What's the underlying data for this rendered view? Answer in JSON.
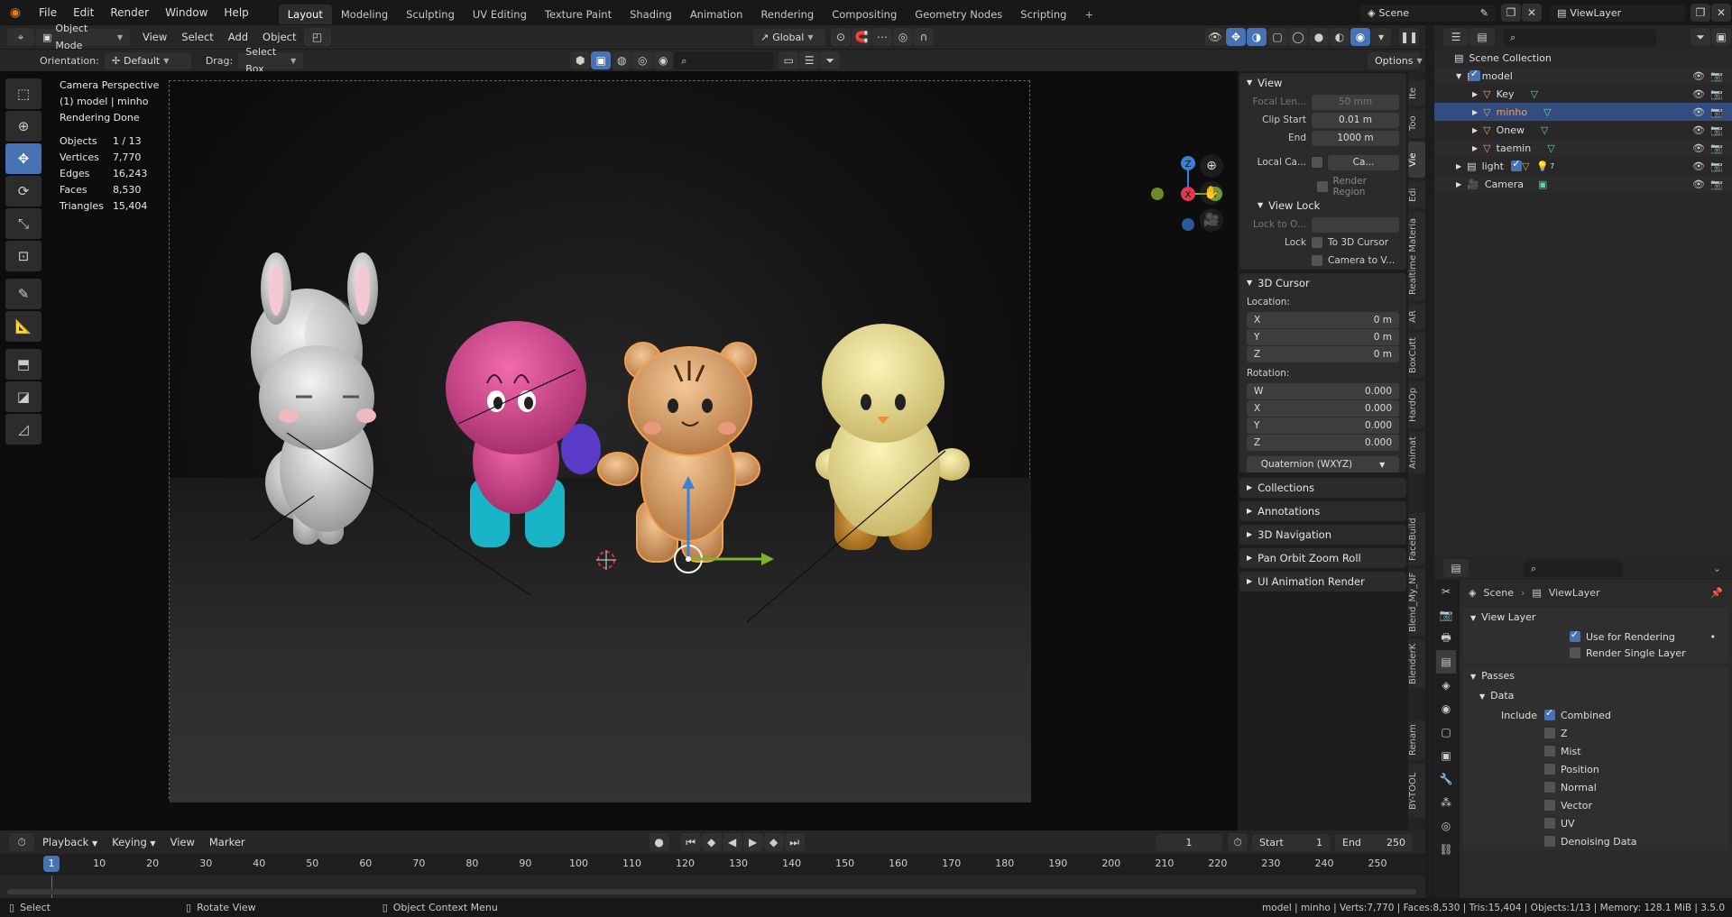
{
  "topbar": {
    "menus": [
      "File",
      "Edit",
      "Render",
      "Window",
      "Help"
    ],
    "workspaces": [
      "Layout",
      "Modeling",
      "Sculpting",
      "UV Editing",
      "Texture Paint",
      "Shading",
      "Animation",
      "Rendering",
      "Compositing",
      "Geometry Nodes",
      "Scripting"
    ],
    "active_workspace": "Layout",
    "scene": "Scene",
    "view_layer": "ViewLayer"
  },
  "header": {
    "mode": "Object Mode",
    "menus": [
      "View",
      "Select",
      "Add",
      "Object"
    ],
    "transform_orientation": "Global",
    "orientation_label": "Orientation:",
    "orientation_value": "Default",
    "drag_label": "Drag:",
    "drag_value": "Select Box",
    "options_label": "Options"
  },
  "viewport": {
    "info_lines": [
      "Camera Perspective",
      "(1) model | minho",
      "Rendering Done"
    ],
    "stats": [
      {
        "label": "Objects",
        "value": "1 / 13"
      },
      {
        "label": "Vertices",
        "value": "7,770"
      },
      {
        "label": "Edges",
        "value": "16,243"
      },
      {
        "label": "Faces",
        "value": "8,530"
      },
      {
        "label": "Triangles",
        "value": "15,404"
      }
    ],
    "gizmo_axes": {
      "z": "Z",
      "x": "X",
      "y": "Y"
    }
  },
  "npanel": {
    "view": {
      "title": "View",
      "focal_length_label": "Focal Len...",
      "focal_length": "50 mm",
      "clip_start_label": "Clip Start",
      "clip_start": "0.01 m",
      "clip_end_label": "End",
      "clip_end": "1000 m",
      "local_camera_label": "Local Ca...",
      "local_camera_value": "Ca...",
      "render_region_label": "Render Region",
      "view_lock_title": "View Lock",
      "lock_to_object_label": "Lock to O...",
      "lock_label": "Lock",
      "lock_3d_cursor": "To 3D Cursor",
      "camera_to_view": "Camera to V..."
    },
    "cursor": {
      "title": "3D Cursor",
      "location_label": "Location:",
      "location": [
        {
          "axis": "X",
          "value": "0 m"
        },
        {
          "axis": "Y",
          "value": "0 m"
        },
        {
          "axis": "Z",
          "value": "0 m"
        }
      ],
      "rotation_label": "Rotation:",
      "rotation": [
        {
          "axis": "W",
          "value": "0.000"
        },
        {
          "axis": "X",
          "value": "0.000"
        },
        {
          "axis": "Y",
          "value": "0.000"
        },
        {
          "axis": "Z",
          "value": "0.000"
        }
      ],
      "rotation_mode": "Quaternion (WXYZ)"
    },
    "collapsed_panels": [
      "Collections",
      "Annotations",
      "3D Navigation",
      "Pan Orbit Zoom Roll",
      "UI Animation Render"
    ],
    "tabs": [
      "Ite",
      "Too",
      "Vie",
      "Edi",
      "Realtime Materia",
      "AR",
      "BoxCutt",
      "HardOp",
      "Animat",
      "FaceBuild",
      "Blend_My_NF",
      "BlenderK",
      "Renam",
      "BY-TOOL"
    ]
  },
  "outliner": {
    "root": "Scene Collection",
    "rows": [
      {
        "name": "model",
        "indent": 1,
        "type": "collection",
        "checked": true
      },
      {
        "name": "Key",
        "indent": 2,
        "type": "object"
      },
      {
        "name": "minho",
        "indent": 2,
        "type": "object",
        "selected": true
      },
      {
        "name": "Onew",
        "indent": 2,
        "type": "object"
      },
      {
        "name": "taemin",
        "indent": 2,
        "type": "object"
      },
      {
        "name": "light",
        "indent": 1,
        "type": "collection",
        "checked": true,
        "badge": "7"
      },
      {
        "name": "Camera",
        "indent": 1,
        "type": "camera"
      }
    ]
  },
  "properties": {
    "breadcrumb_scene": "Scene",
    "breadcrumb_layer": "ViewLayer",
    "view_layer_title": "View Layer",
    "use_for_rendering": "Use for Rendering",
    "render_single_layer": "Render Single Layer",
    "passes_title": "Passes",
    "data_title": "Data",
    "include_label": "Include",
    "passes": [
      {
        "name": "Combined",
        "checked": true
      },
      {
        "name": "Z",
        "checked": false
      },
      {
        "name": "Mist",
        "checked": false
      },
      {
        "name": "Position",
        "checked": false
      },
      {
        "name": "Normal",
        "checked": false
      },
      {
        "name": "Vector",
        "checked": false
      },
      {
        "name": "UV",
        "checked": false
      },
      {
        "name": "Denoising Data",
        "checked": false
      }
    ]
  },
  "timeline": {
    "menus": [
      "Playback",
      "Keying",
      "View",
      "Marker"
    ],
    "current_frame": "1",
    "start_label": "Start",
    "start": "1",
    "end_label": "End",
    "end": "250",
    "ruler": [
      "1",
      "10",
      "20",
      "30",
      "40",
      "50",
      "60",
      "70",
      "80",
      "90",
      "100",
      "110",
      "120",
      "130",
      "140",
      "150",
      "160",
      "170",
      "180",
      "190",
      "200",
      "210",
      "220",
      "230",
      "240",
      "250"
    ]
  },
  "statusbar": {
    "select": "Select",
    "rotate": "Rotate View",
    "context": "Object Context Menu",
    "info": "model | minho | Verts:7,770 | Faces:8,530 | Tris:15,404 | Objects:1/13 | Memory: 128.1 MiB | 3.5.0"
  },
  "colors": {
    "accent": "#4772b3",
    "selected_outline": "#f5a04a",
    "axis_x": "#e0384b",
    "axis_y": "#7bb32e",
    "axis_z": "#3a7fd8"
  }
}
